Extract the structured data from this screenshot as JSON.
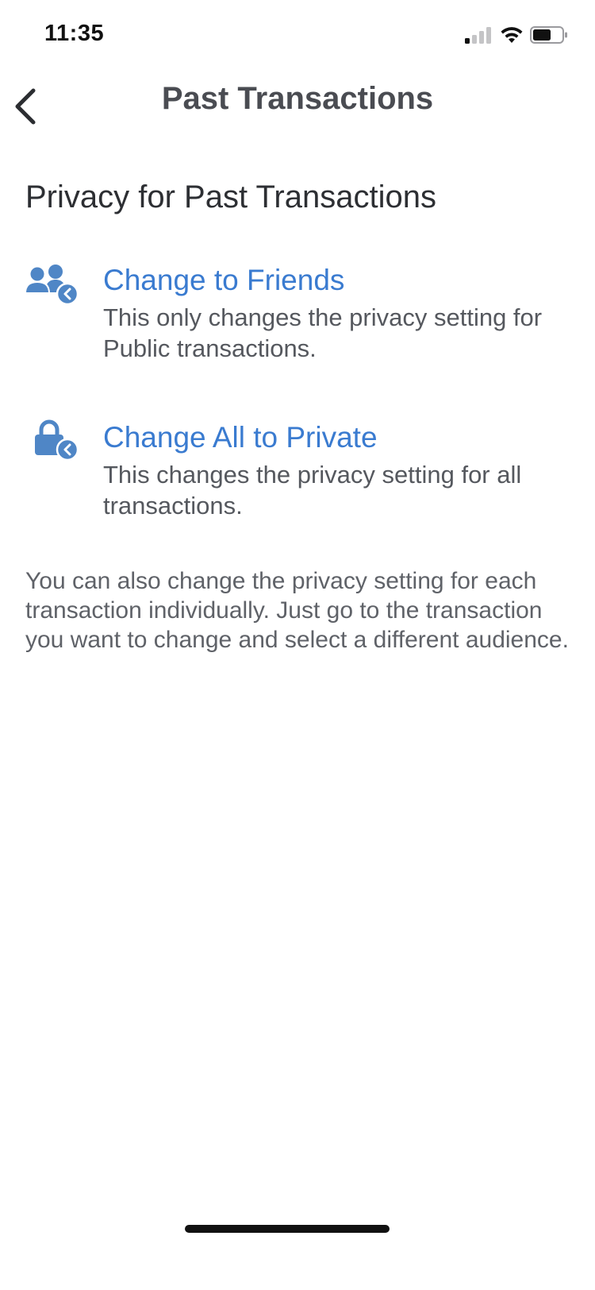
{
  "status_bar": {
    "time": "11:35"
  },
  "nav": {
    "title": "Past Transactions",
    "back_icon": "chevron-left-icon"
  },
  "section": {
    "heading": "Privacy for Past Transactions"
  },
  "options": [
    {
      "title": "Change to Friends",
      "description": "This only changes the privacy setting for Public transactions.",
      "icon": "friends-icon"
    },
    {
      "title": "Change All to Private",
      "description": "This changes the privacy setting for all transactions.",
      "icon": "lock-icon"
    }
  ],
  "info": {
    "text": "You can also change the privacy setting for each transaction individually. Just go to the transaction you want to change and select a different audience."
  },
  "colors": {
    "accent": "#3a7bd0",
    "icon_blue": "#4f86c6"
  }
}
